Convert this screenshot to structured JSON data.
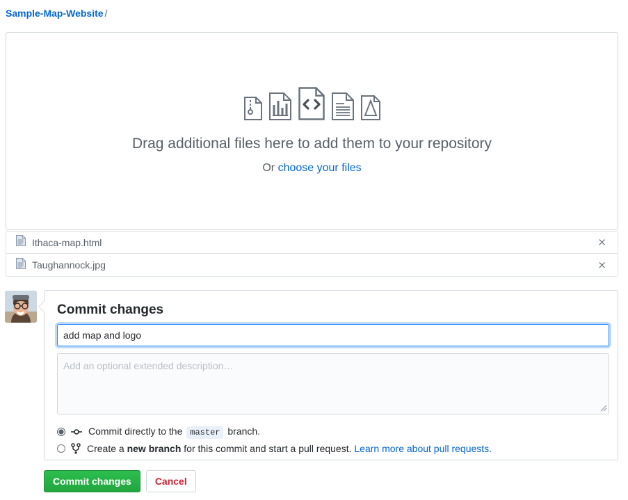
{
  "breadcrumb": {
    "repo": "Sample-Map-Website",
    "separator": "/"
  },
  "dropzone": {
    "message": "Drag additional files here to add them to your repository",
    "or_label": "Or",
    "choose_link": "choose your files",
    "icons": [
      "archive-file-icon",
      "chart-file-icon",
      "code-file-icon",
      "text-file-icon",
      "pdf-file-icon"
    ]
  },
  "uploaded_files": [
    {
      "name": "Ithaca-map.html",
      "remove_label": "×"
    },
    {
      "name": "Taughannock.jpg",
      "remove_label": "×"
    }
  ],
  "commit": {
    "title": "Commit changes",
    "message_value": "add map and logo",
    "description_placeholder": "Add an optional extended description…",
    "options": {
      "direct": {
        "text_before": "Commit directly to the",
        "branch": "master",
        "text_after": "branch.",
        "selected": true
      },
      "branch": {
        "text_before": "Create a",
        "emphasis": "new branch",
        "text_after": "for this commit and start a pull request.",
        "link": "Learn more about pull requests.",
        "selected": false
      }
    },
    "submit_label": "Commit changes",
    "cancel_label": "Cancel"
  },
  "colors": {
    "link": "#0366d6",
    "primary_button": "#2cbe4e",
    "cancel_text": "#cb2431",
    "focus_border": "#2188ff"
  }
}
